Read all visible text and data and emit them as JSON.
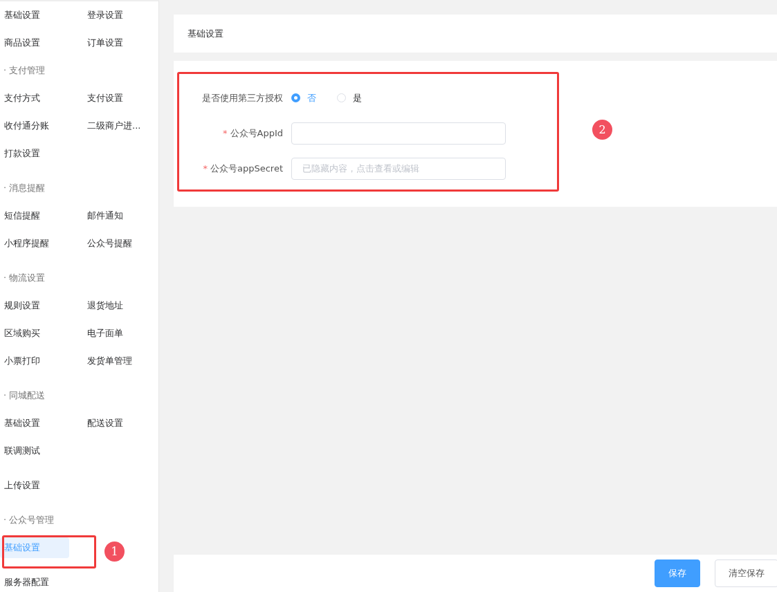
{
  "sidebar": {
    "sections": [
      {
        "items": [
          {
            "label": "基础设置",
            "selected": false
          },
          {
            "label": "登录设置",
            "selected": false
          },
          {
            "label": "商品设置",
            "selected": false
          },
          {
            "label": "订单设置",
            "selected": false
          }
        ]
      },
      {
        "heading": "· 支付管理",
        "items": [
          {
            "label": "支付方式",
            "selected": false
          },
          {
            "label": "支付设置",
            "selected": false
          },
          {
            "label": "收付通分账",
            "selected": false
          },
          {
            "label": "二级商户进...",
            "selected": false
          },
          {
            "label": "打款设置",
            "selected": false
          }
        ]
      },
      {
        "heading": "· 消息提醒",
        "items": [
          {
            "label": "短信提醒",
            "selected": false
          },
          {
            "label": "邮件通知",
            "selected": false
          },
          {
            "label": "小程序提醒",
            "selected": false
          },
          {
            "label": "公众号提醒",
            "selected": false
          }
        ]
      },
      {
        "heading": "· 物流设置",
        "items": [
          {
            "label": "规则设置",
            "selected": false
          },
          {
            "label": "退货地址",
            "selected": false
          },
          {
            "label": "区域购买",
            "selected": false
          },
          {
            "label": "电子面单",
            "selected": false
          },
          {
            "label": "小票打印",
            "selected": false
          },
          {
            "label": "发货单管理",
            "selected": false
          }
        ]
      },
      {
        "heading": "· 同城配送",
        "items": [
          {
            "label": "基础设置",
            "selected": false
          },
          {
            "label": "配送设置",
            "selected": false
          },
          {
            "label": "联调测试",
            "selected": false
          }
        ]
      },
      {
        "items": [
          {
            "label": "上传设置",
            "selected": false
          }
        ]
      },
      {
        "heading": "· 公众号管理",
        "items": [
          {
            "label": "基础设置",
            "selected": true,
            "annotation": "1"
          }
        ]
      },
      {
        "items": [
          {
            "label": "服务器配置",
            "selected": false
          }
        ]
      }
    ]
  },
  "header": {
    "title": "基础设置"
  },
  "form": {
    "annotation": "2",
    "fields": [
      {
        "kind": "radio",
        "label": "是否使用第三方授权",
        "options": [
          {
            "label": "否",
            "selected": true
          },
          {
            "label": "是",
            "selected": false
          }
        ]
      },
      {
        "kind": "input",
        "required_mark": "*",
        "label": "公众号AppId"
      },
      {
        "kind": "input",
        "required_mark": "*",
        "label": "公众号appSecret",
        "placeholder": "已隐藏内容，点击查看或编辑"
      }
    ]
  },
  "footer": {
    "buttons": [
      {
        "label": "保存",
        "kind": "primary"
      },
      {
        "label": "清空保存",
        "kind": "default"
      }
    ]
  }
}
